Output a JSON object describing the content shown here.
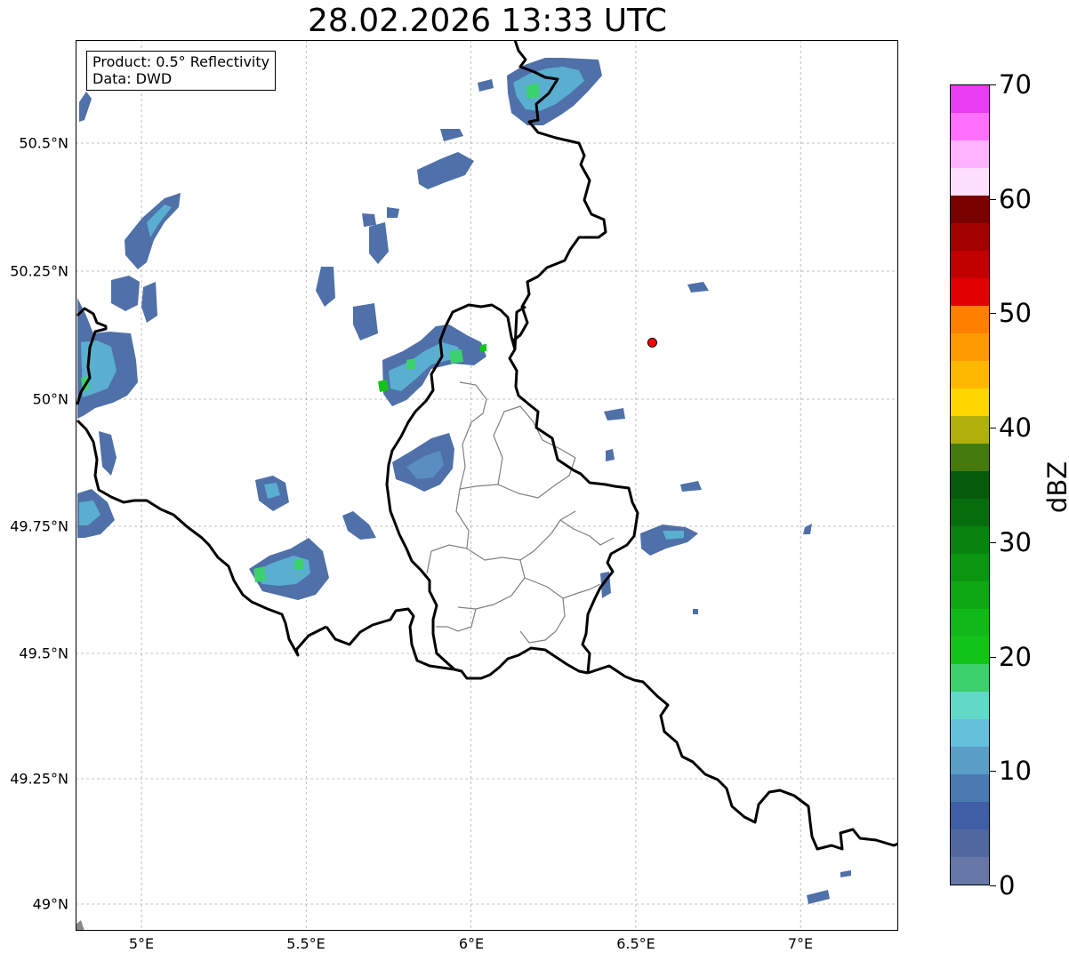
{
  "title": "28.02.2026 13:33 UTC",
  "info_box": {
    "line1": "Product: 0.5° Reflectivity",
    "line2": "Data: DWD"
  },
  "axes": {
    "lat_labels": [
      "50.5°N",
      "50.25°N",
      "50°N",
      "49.75°N",
      "49.5°N",
      "49.25°N",
      "49°N"
    ],
    "lon_labels": [
      "5°E",
      "5.5°E",
      "6°E",
      "6.5°E",
      "7°E"
    ]
  },
  "colorbar": {
    "unit": "dBZ",
    "tick_labels": [
      "0",
      "10",
      "20",
      "30",
      "40",
      "50",
      "60",
      "70"
    ],
    "min": 0,
    "max": 70,
    "step": 2.5,
    "colors": [
      "#6677a8",
      "#5068a0",
      "#3f5ea6",
      "#4a7ab2",
      "#5a9ec8",
      "#65c0db",
      "#62d8c8",
      "#3dd16e",
      "#12c417",
      "#10b81a",
      "#0ea814",
      "#0b9612",
      "#0a8210",
      "#076c0c",
      "#055b0a",
      "#447a0e",
      "#b0b10c",
      "#ffd700",
      "#ffb800",
      "#ff9900",
      "#ff8000",
      "#e00000",
      "#c20000",
      "#a30000",
      "#7a0000",
      "#ffe0ff",
      "#ffb3ff",
      "#ff70ff",
      "#e83df0"
    ]
  },
  "marker": {
    "lat": 50.11,
    "lon": 6.55,
    "color": "#ff0000"
  },
  "colors": {
    "border": "#000000",
    "admin": "#808080",
    "grid": "#b0b0b0"
  }
}
